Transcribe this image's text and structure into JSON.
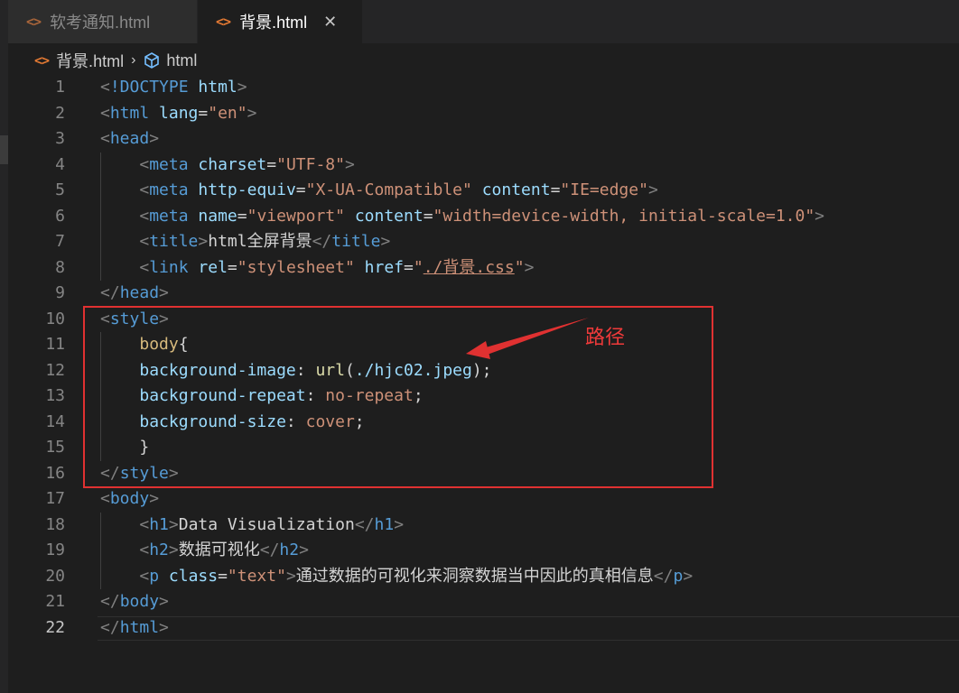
{
  "tabs": [
    {
      "label": "软考通知.html",
      "icon": "code-icon",
      "active": false
    },
    {
      "label": "背景.html",
      "icon": "code-icon",
      "active": true,
      "close": "✕"
    }
  ],
  "breadcrumb": {
    "file": "背景.html",
    "separator": "›",
    "symbol": "html"
  },
  "annotation": {
    "label": "路径",
    "color": "#e03131"
  },
  "current_line": 22,
  "code_lines": [
    {
      "n": "1",
      "tokens": [
        [
          "t-br",
          "<"
        ],
        [
          "t-tag",
          "!DOCTYPE"
        ],
        [
          "t-txt",
          " "
        ],
        [
          "t-attr",
          "html"
        ],
        [
          "t-br",
          ">"
        ]
      ]
    },
    {
      "n": "2",
      "tokens": [
        [
          "t-br",
          "<"
        ],
        [
          "t-tag",
          "html"
        ],
        [
          "t-txt",
          " "
        ],
        [
          "t-attr",
          "lang"
        ],
        [
          "t-txt",
          "="
        ],
        [
          "t-str",
          "\"en\""
        ],
        [
          "t-br",
          ">"
        ]
      ]
    },
    {
      "n": "3",
      "tokens": [
        [
          "t-br",
          "<"
        ],
        [
          "t-tag",
          "head"
        ],
        [
          "t-br",
          ">"
        ]
      ]
    },
    {
      "n": "4",
      "tokens": [
        [
          "t-txt",
          "    "
        ],
        [
          "t-br",
          "<"
        ],
        [
          "t-tag",
          "meta"
        ],
        [
          "t-txt",
          " "
        ],
        [
          "t-attr",
          "charset"
        ],
        [
          "t-txt",
          "="
        ],
        [
          "t-str",
          "\"UTF-8\""
        ],
        [
          "t-br",
          ">"
        ]
      ]
    },
    {
      "n": "5",
      "tokens": [
        [
          "t-txt",
          "    "
        ],
        [
          "t-br",
          "<"
        ],
        [
          "t-tag",
          "meta"
        ],
        [
          "t-txt",
          " "
        ],
        [
          "t-attr",
          "http-equiv"
        ],
        [
          "t-txt",
          "="
        ],
        [
          "t-str",
          "\"X-UA-Compatible\""
        ],
        [
          "t-txt",
          " "
        ],
        [
          "t-attr",
          "content"
        ],
        [
          "t-txt",
          "="
        ],
        [
          "t-str",
          "\"IE=edge\""
        ],
        [
          "t-br",
          ">"
        ]
      ]
    },
    {
      "n": "6",
      "tokens": [
        [
          "t-txt",
          "    "
        ],
        [
          "t-br",
          "<"
        ],
        [
          "t-tag",
          "meta"
        ],
        [
          "t-txt",
          " "
        ],
        [
          "t-attr",
          "name"
        ],
        [
          "t-txt",
          "="
        ],
        [
          "t-str",
          "\"viewport\""
        ],
        [
          "t-txt",
          " "
        ],
        [
          "t-attr",
          "content"
        ],
        [
          "t-txt",
          "="
        ],
        [
          "t-str",
          "\"width=device-width, initial-scale=1.0\""
        ],
        [
          "t-br",
          ">"
        ]
      ]
    },
    {
      "n": "7",
      "tokens": [
        [
          "t-txt",
          "    "
        ],
        [
          "t-br",
          "<"
        ],
        [
          "t-tag",
          "title"
        ],
        [
          "t-br",
          ">"
        ],
        [
          "t-txt",
          "html"
        ],
        [
          "t-txt cjk",
          "全屏背景"
        ],
        [
          "t-br",
          "</"
        ],
        [
          "t-tag",
          "title"
        ],
        [
          "t-br",
          ">"
        ]
      ]
    },
    {
      "n": "8",
      "tokens": [
        [
          "t-txt",
          "    "
        ],
        [
          "t-br",
          "<"
        ],
        [
          "t-tag",
          "link"
        ],
        [
          "t-txt",
          " "
        ],
        [
          "t-attr",
          "rel"
        ],
        [
          "t-txt",
          "="
        ],
        [
          "t-str",
          "\"stylesheet\""
        ],
        [
          "t-txt",
          " "
        ],
        [
          "t-attr",
          "href"
        ],
        [
          "t-txt",
          "="
        ],
        [
          "t-str",
          "\""
        ],
        [
          "t-str t-link",
          "./背景.css"
        ],
        [
          "t-str",
          "\""
        ],
        [
          "t-br",
          ">"
        ]
      ]
    },
    {
      "n": "9",
      "tokens": [
        [
          "t-br",
          "</"
        ],
        [
          "t-tag",
          "head"
        ],
        [
          "t-br",
          ">"
        ]
      ]
    },
    {
      "n": "10",
      "tokens": [
        [
          "t-br",
          "<"
        ],
        [
          "t-tag",
          "style"
        ],
        [
          "t-br",
          ">"
        ]
      ]
    },
    {
      "n": "11",
      "tokens": [
        [
          "t-txt",
          "    "
        ],
        [
          "t-sel",
          "body"
        ],
        [
          "t-txt",
          "{"
        ]
      ]
    },
    {
      "n": "12",
      "tokens": [
        [
          "t-txt",
          "    "
        ],
        [
          "t-prop",
          "background-image"
        ],
        [
          "t-txt",
          ": "
        ],
        [
          "t-fn",
          "url"
        ],
        [
          "t-txt",
          "("
        ],
        [
          "t-url",
          "./hjc02.jpeg"
        ],
        [
          "t-txt",
          ");"
        ]
      ]
    },
    {
      "n": "13",
      "tokens": [
        [
          "t-txt",
          "    "
        ],
        [
          "t-prop",
          "background-repeat"
        ],
        [
          "t-txt",
          ": "
        ],
        [
          "t-val",
          "no-repeat"
        ],
        [
          "t-txt",
          ";"
        ]
      ]
    },
    {
      "n": "14",
      "tokens": [
        [
          "t-txt",
          "    "
        ],
        [
          "t-prop",
          "background-size"
        ],
        [
          "t-txt",
          ": "
        ],
        [
          "t-val",
          "cover"
        ],
        [
          "t-txt",
          ";"
        ]
      ]
    },
    {
      "n": "15",
      "tokens": [
        [
          "t-txt",
          "    }"
        ]
      ]
    },
    {
      "n": "16",
      "tokens": [
        [
          "t-br",
          "</"
        ],
        [
          "t-tag",
          "style"
        ],
        [
          "t-br",
          ">"
        ]
      ]
    },
    {
      "n": "17",
      "tokens": [
        [
          "t-br",
          "<"
        ],
        [
          "t-tag",
          "body"
        ],
        [
          "t-br",
          ">"
        ]
      ]
    },
    {
      "n": "18",
      "tokens": [
        [
          "t-txt",
          "    "
        ],
        [
          "t-br",
          "<"
        ],
        [
          "t-tag",
          "h1"
        ],
        [
          "t-br",
          ">"
        ],
        [
          "t-txt",
          "Data Visualization"
        ],
        [
          "t-br",
          "</"
        ],
        [
          "t-tag",
          "h1"
        ],
        [
          "t-br",
          ">"
        ]
      ]
    },
    {
      "n": "19",
      "tokens": [
        [
          "t-txt",
          "    "
        ],
        [
          "t-br",
          "<"
        ],
        [
          "t-tag",
          "h2"
        ],
        [
          "t-br",
          ">"
        ],
        [
          "t-txt cjk",
          "数据可视化"
        ],
        [
          "t-br",
          "</"
        ],
        [
          "t-tag",
          "h2"
        ],
        [
          "t-br",
          ">"
        ]
      ]
    },
    {
      "n": "20",
      "tokens": [
        [
          "t-txt",
          "    "
        ],
        [
          "t-br",
          "<"
        ],
        [
          "t-tag",
          "p"
        ],
        [
          "t-txt",
          " "
        ],
        [
          "t-attr",
          "class"
        ],
        [
          "t-txt",
          "="
        ],
        [
          "t-str",
          "\"text\""
        ],
        [
          "t-br",
          ">"
        ],
        [
          "t-txt cjk",
          "通过数据的可视化来洞察数据当中因此的真相信息"
        ],
        [
          "t-br",
          "</"
        ],
        [
          "t-tag",
          "p"
        ],
        [
          "t-br",
          ">"
        ]
      ]
    },
    {
      "n": "21",
      "tokens": [
        [
          "t-br",
          "</"
        ],
        [
          "t-tag",
          "body"
        ],
        [
          "t-br",
          ">"
        ]
      ]
    },
    {
      "n": "22",
      "tokens": [
        [
          "t-br",
          "</"
        ],
        [
          "t-tag",
          "html"
        ],
        [
          "t-br",
          ">"
        ]
      ]
    }
  ]
}
